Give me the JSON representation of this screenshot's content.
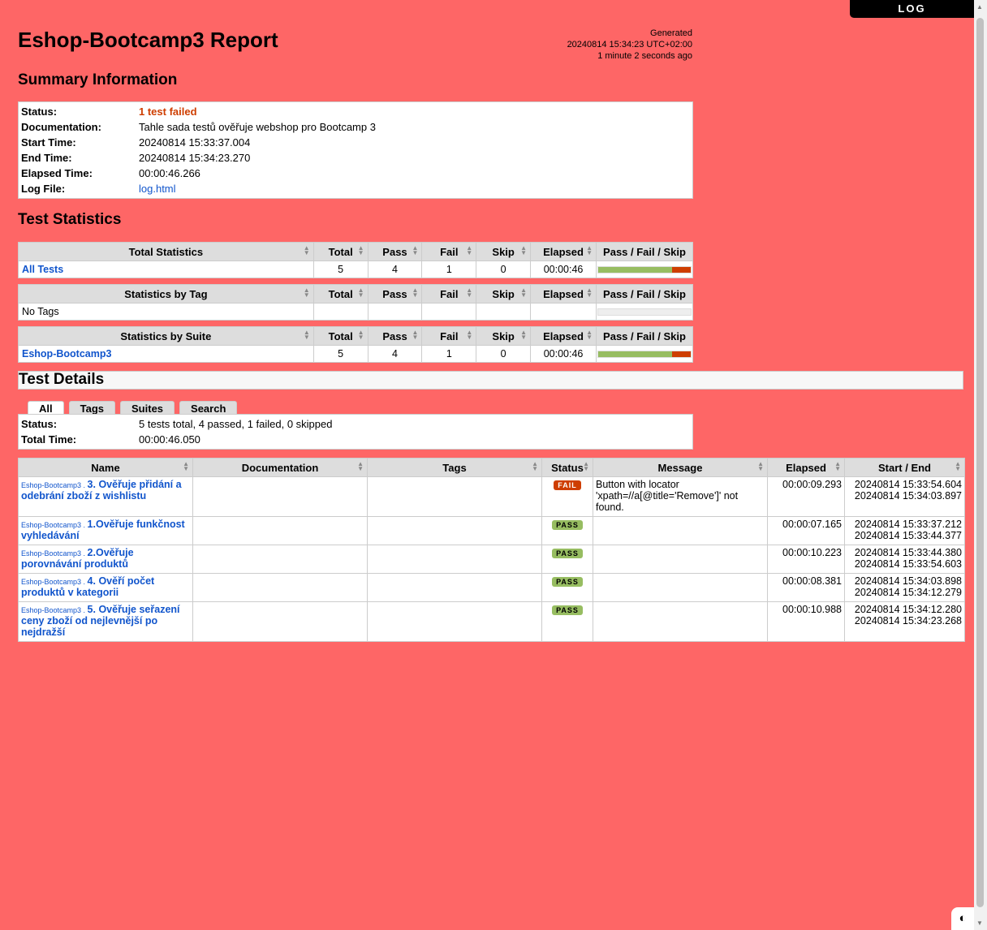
{
  "log_button": "LOG",
  "header": {
    "title": "Eshop-Bootcamp3 Report",
    "generated_label": "Generated",
    "generated_time": "20240814 15:34:23 UTC+02:00",
    "generated_ago": "1 minute 2 seconds ago"
  },
  "summary": {
    "heading": "Summary Information",
    "rows": [
      {
        "key": "Status:",
        "value": "1 test failed"
      },
      {
        "key": "Documentation:",
        "value": "Tahle sada testů ověřuje webshop pro Bootcamp 3"
      },
      {
        "key": "Start Time:",
        "value": "20240814 15:33:37.004"
      },
      {
        "key": "End Time:",
        "value": "20240814 15:34:23.270"
      },
      {
        "key": "Elapsed Time:",
        "value": "00:00:46.266"
      },
      {
        "key": "Log File:",
        "value": "log.html"
      }
    ]
  },
  "statistics": {
    "heading": "Test Statistics",
    "columns": [
      "Total",
      "Pass",
      "Fail",
      "Skip",
      "Elapsed",
      "Pass / Fail / Skip"
    ],
    "total": {
      "title": "Total Statistics",
      "row": {
        "name": "All Tests",
        "total": "5",
        "pass": "4",
        "fail": "1",
        "skip": "0",
        "elapsed": "00:00:46",
        "pass_ratio": 0.8,
        "fail_ratio": 0.2
      }
    },
    "tag": {
      "title": "Statistics by Tag",
      "row": {
        "name": "No Tags"
      }
    },
    "suite": {
      "title": "Statistics by Suite",
      "row": {
        "name": "Eshop-Bootcamp3",
        "total": "5",
        "pass": "4",
        "fail": "1",
        "skip": "0",
        "elapsed": "00:00:46",
        "pass_ratio": 0.8,
        "fail_ratio": 0.2
      }
    }
  },
  "details": {
    "heading": "Test Details",
    "tabs": [
      "All",
      "Tags",
      "Suites",
      "Search"
    ],
    "status_label": "Status:",
    "status_value": "5 tests total, 4 passed, 1 failed, 0 skipped",
    "time_label": "Total Time:",
    "time_value": "00:00:46.050",
    "columns": [
      "Name",
      "Documentation",
      "Tags",
      "Status",
      "Message",
      "Elapsed",
      "Start / End"
    ],
    "rows": [
      {
        "prefix": "Eshop-Bootcamp3 . ",
        "name": "3. Ověřuje přidání a odebrání zboží z wishlistu",
        "status": "FAIL",
        "message": "Button with locator 'xpath=//a[@title='Remove']' not found.",
        "elapsed": "00:00:09.293",
        "start": "20240814 15:33:54.604",
        "end": "20240814 15:34:03.897"
      },
      {
        "prefix": "Eshop-Bootcamp3 . ",
        "name": "1.Ověřuje funkčnost vyhledávání",
        "status": "PASS",
        "message": "",
        "elapsed": "00:00:07.165",
        "start": "20240814 15:33:37.212",
        "end": "20240814 15:33:44.377"
      },
      {
        "prefix": "Eshop-Bootcamp3 . ",
        "name": "2.Ověřuje porovnávání produktů",
        "status": "PASS",
        "message": "",
        "elapsed": "00:00:10.223",
        "start": "20240814 15:33:44.380",
        "end": "20240814 15:33:54.603"
      },
      {
        "prefix": "Eshop-Bootcamp3 . ",
        "name": "4. Ověří počet produktů v kategorii",
        "status": "PASS",
        "message": "",
        "elapsed": "00:00:08.381",
        "start": "20240814 15:34:03.898",
        "end": "20240814 15:34:12.279"
      },
      {
        "prefix": "Eshop-Bootcamp3 . ",
        "name": "5. Ověřuje seřazení ceny zboží od nejlevnější po nejdražší",
        "status": "PASS",
        "message": "",
        "elapsed": "00:00:10.988",
        "start": "20240814 15:34:12.280",
        "end": "20240814 15:34:23.268"
      }
    ]
  },
  "colors": {
    "background": "#fe6666",
    "pass": "#97bd61",
    "fail": "#ce3e01",
    "link": "#1155cc"
  },
  "icons": [
    "sort-icon",
    "remove-column-icon",
    "theme-toggle-icon"
  ]
}
